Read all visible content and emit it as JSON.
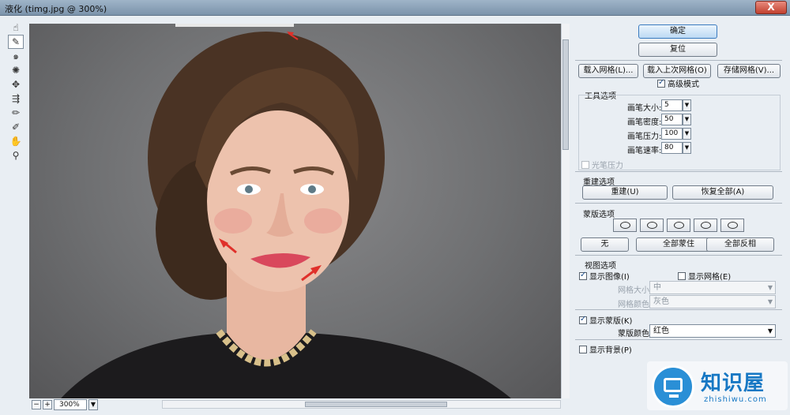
{
  "window": {
    "title": "液化 (timg.jpg @ 300%)",
    "close_label": "X"
  },
  "tools": [
    {
      "name": "forward-warp-icon",
      "glyph": "☝"
    },
    {
      "name": "reconstruct-icon",
      "glyph": "✎"
    },
    {
      "name": "twirl-icon",
      "glyph": "๑"
    },
    {
      "name": "pucker-icon",
      "glyph": "✺"
    },
    {
      "name": "bloat-icon",
      "glyph": "✥"
    },
    {
      "name": "push-left-icon",
      "glyph": "⇶"
    },
    {
      "name": "freeze-mask-icon",
      "glyph": "✏"
    },
    {
      "name": "thaw-mask-icon",
      "glyph": "✐"
    },
    {
      "name": "hand-icon",
      "glyph": "✋"
    },
    {
      "name": "zoom-icon",
      "glyph": "⚲"
    }
  ],
  "zoom": {
    "value": "300%"
  },
  "buttons": {
    "ok": "确定",
    "reset": "复位",
    "load_mesh": "载入网格(L)...",
    "load_last_mesh": "载入上次网格(O)",
    "save_mesh": "存储网格(V)..."
  },
  "advanced_mode": {
    "label": "高级模式",
    "checked": true
  },
  "tool_options": {
    "title": "工具选项",
    "fields": [
      {
        "label": "画笔大小:",
        "value": "5"
      },
      {
        "label": "画笔密度:",
        "value": "50"
      },
      {
        "label": "画笔压力:",
        "value": "100"
      },
      {
        "label": "画笔速率:",
        "value": "80"
      }
    ],
    "stylus_pressure": {
      "label": "光笔压力",
      "checked": false
    }
  },
  "reconstruct_options": {
    "title": "重建选项",
    "reconstruct": "重建(U)",
    "restore_all": "恢复全部(A)"
  },
  "mask_options": {
    "title": "蒙版选项",
    "none": "无",
    "mask_all": "全部蒙住",
    "invert_all": "全部反相"
  },
  "view_options": {
    "title": "视图选项",
    "show_image": {
      "label": "显示图像(I)",
      "checked": true
    },
    "show_mesh": {
      "label": "显示网格(E)",
      "checked": false
    },
    "mesh_size": {
      "label": "网格大小:",
      "value": "中"
    },
    "mesh_color": {
      "label": "网格颜色:",
      "value": "灰色"
    },
    "show_mask": {
      "label": "显示蒙版(K)",
      "checked": true
    },
    "mask_color": {
      "label": "蒙版颜色:",
      "value": "红色"
    },
    "show_backdrop": {
      "label": "显示背景(P)",
      "checked": false
    }
  },
  "watermark": {
    "name": "知识屋",
    "url": "zhishiwu.com"
  },
  "colors": {
    "mask_red": "#e0302a",
    "accent": "#3b7bbf"
  }
}
